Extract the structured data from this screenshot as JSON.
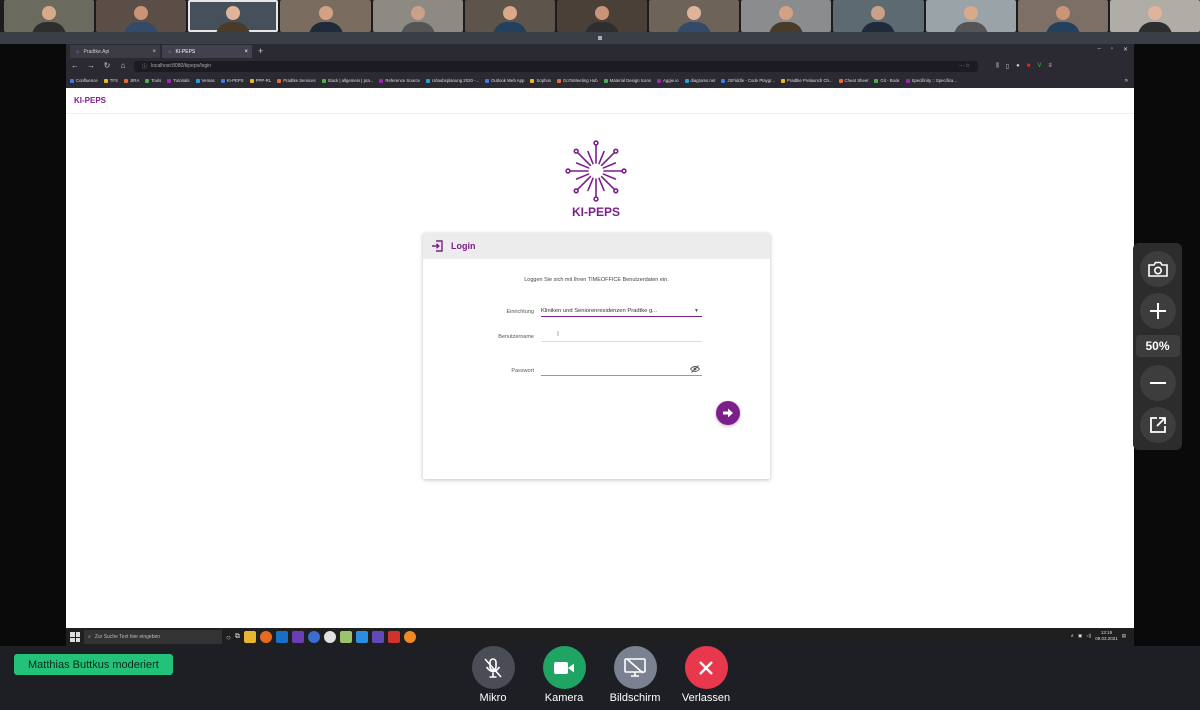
{
  "meeting": {
    "participants_count": 13,
    "moderator_badge": "Matthias Buttkus moderiert",
    "zoom_level": "50%",
    "controls": [
      {
        "id": "mic",
        "label": "Mikro",
        "color": "#4a4d55"
      },
      {
        "id": "camera",
        "label": "Kamera",
        "color": "#1fa463"
      },
      {
        "id": "screen",
        "label": "Bildschirm",
        "color": "#7a8190"
      },
      {
        "id": "leave",
        "label": "Verlassen",
        "color": "#e8394c"
      }
    ]
  },
  "browser": {
    "tabs": [
      {
        "label": "Pradtke.Api"
      },
      {
        "label": "KI-PEPS"
      }
    ],
    "url": "localhost:8080/kipeps/login",
    "bookmarks": [
      "Confluence",
      "TFS",
      "JIRA",
      "Tools",
      "Tutorials",
      "Vemas",
      "KI-PEPS",
      "PPP-RL",
      "Pradtke.Services",
      "Slack | allgemein | pra...",
      "Reference Source",
      "Urlaubsplanung 2020 -...",
      "Outlook Web App",
      "Sophos",
      "GoToMeeting Hub",
      "Material Design Icons",
      "Aggie.io",
      "diagrams.net",
      "JSFiddle - Code Playgr...",
      "Pradtke Prelaunch Ch...",
      "Cheat Sheet",
      "Git - Book",
      "Specifinity :: Specifica..."
    ]
  },
  "app": {
    "header_title": "KI-PEPS",
    "brand_name": "KI-PEPS",
    "login": {
      "title": "Login",
      "info": "Loggen Sie sich mit Ihren TIMEOFFICE Benutzerdaten ein.",
      "einrichtung_label": "Einrichtung",
      "einrichtung_value": "Kliniken und Seniorenresidenzen Pradtke g...",
      "username_label": "Benutzername",
      "username_value": "",
      "password_label": "Passwort",
      "password_value": ""
    },
    "accent_color": "#7b1f8a"
  },
  "taskbar": {
    "search_placeholder": "Zur Suche Text hier eingeben",
    "time": "13:19",
    "date": "09.03.2021"
  }
}
